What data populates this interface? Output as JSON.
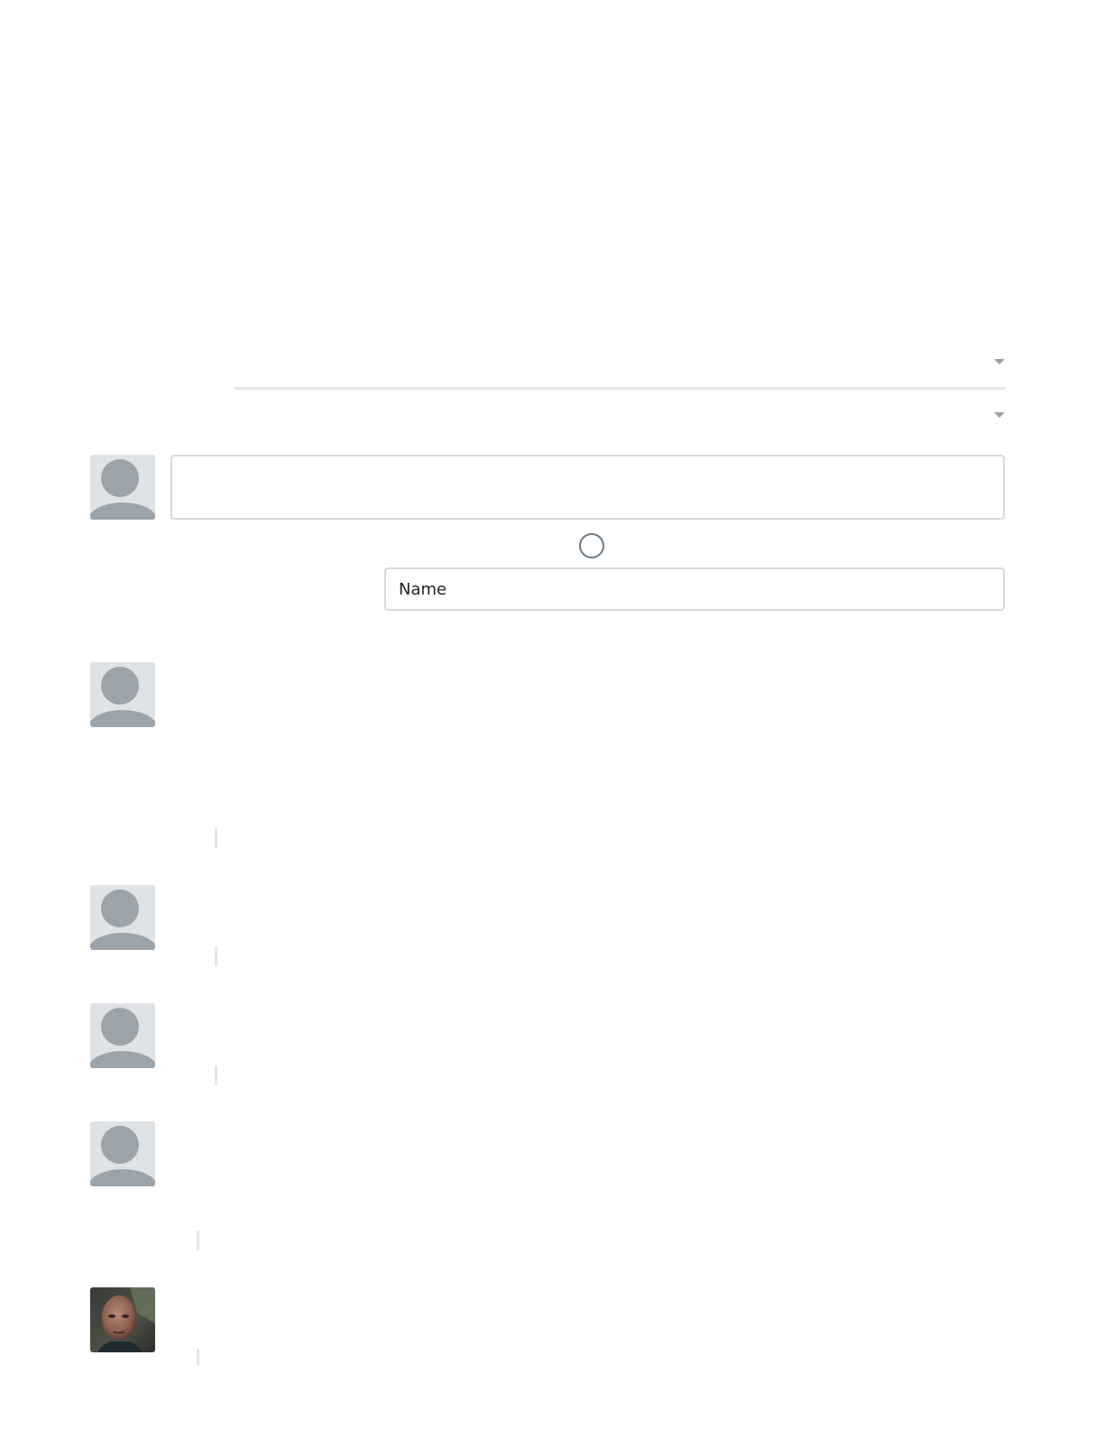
{
  "comments_header": {
    "sort_menu_icon": "caret-down-icon",
    "filter_menu_icon": "caret-down-icon"
  },
  "composer": {
    "avatar_icon": "default-user-icon",
    "comment_placeholder": "",
    "loading_icon": "spinner-icon",
    "name_placeholder": "Name"
  },
  "comments": [
    {
      "avatar": "default-user-icon"
    },
    {
      "avatar": "default-user-icon"
    },
    {
      "avatar": "default-user-icon"
    },
    {
      "avatar": "default-user-icon"
    },
    {
      "avatar": "user-photo"
    }
  ],
  "colors": {
    "avatar_bg": "#dfe3e6",
    "avatar_silhouette": "#9ba3ab",
    "border": "#d7d9dc",
    "spinner": "#6a7a88"
  }
}
